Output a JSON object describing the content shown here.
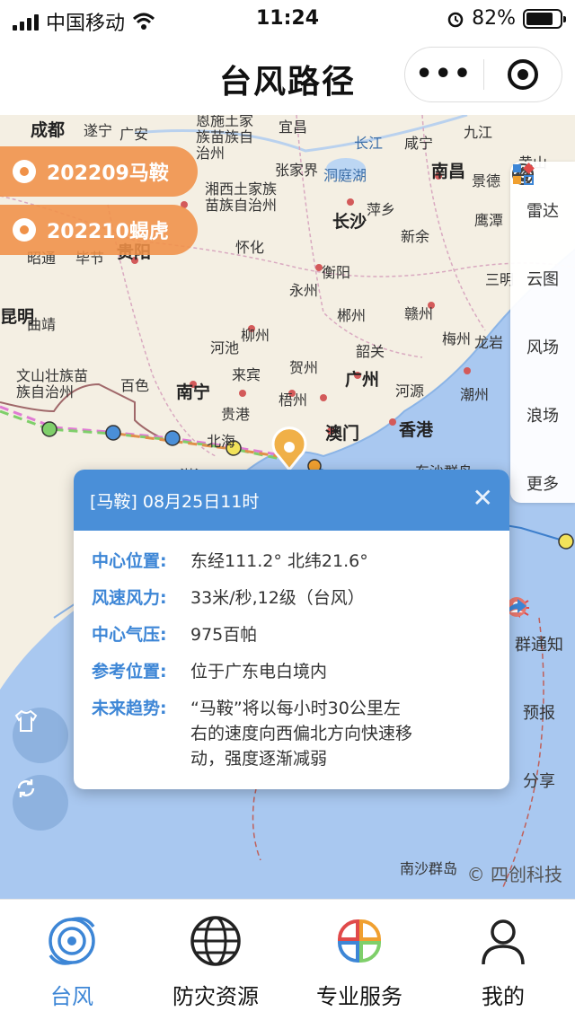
{
  "status_bar": {
    "carrier": "中国移动",
    "time": "11:24",
    "battery": "82%"
  },
  "header": {
    "title": "台风路径",
    "more_label": "•••"
  },
  "typhoons": [
    {
      "label": "202209马鞍"
    },
    {
      "label": "202210蝎虎"
    }
  ],
  "map_labels": {
    "chengdu": "成都",
    "suining": "遂宁",
    "guangan": "广安",
    "yichang": "宜昌",
    "jiujiang": "九江",
    "huangshan": "黄山",
    "enshi": "恩施土家族苗族自治州",
    "changjiang": "长江",
    "xianning": "咸宁",
    "zhangjiajie": "张家界",
    "dongtinghu": "洞庭湖",
    "nanchang": "南昌",
    "jingdezhen": "景德",
    "xiangxi": "湘西土家族苗族自治州",
    "pingxiang": "萍乡",
    "yingtan": "鹰潭",
    "changsha": "长沙",
    "xinyu": "新余",
    "zhaotong": "昭通",
    "bijie": "毕节",
    "guiyang": "贵阳",
    "huaihua": "怀化",
    "hengyang": "衡阳",
    "sanming": "三明",
    "yongzhou": "永州",
    "chenzhou": "郴州",
    "ganzhou": "赣州",
    "kunming": "昆明",
    "qujing": "曲靖",
    "liuzhou": "柳州",
    "hechi": "河池",
    "shaoguan": "韶关",
    "meizhou": "梅州",
    "longyan": "龙岩",
    "wenshan": "文山壮族苗族自治州",
    "baise": "百色",
    "laibin": "来宾",
    "hezhou": "贺州",
    "guangzhou": "广州",
    "heyuan": "河源",
    "chaozhou": "潮州",
    "nanning": "南宁",
    "guigang": "贵港",
    "wuzhou": "梧州",
    "macau": "澳门",
    "hongkong": "香港",
    "beihai": "北海",
    "zhanjiang": "湛江",
    "dongsha": "东沙群岛",
    "nansha": "南沙群岛"
  },
  "side_buttons": [
    {
      "label": "雷达",
      "icon": "radar-icon"
    },
    {
      "label": "云图",
      "icon": "satellite-icon"
    },
    {
      "label": "风场",
      "icon": "wind-icon"
    },
    {
      "label": "浪场",
      "icon": "wave-icon"
    },
    {
      "label": "更多",
      "icon": "grid-icon"
    }
  ],
  "side_buttons2": [
    {
      "label": "群通知",
      "icon": "megaphone-icon"
    },
    {
      "label": "预报",
      "icon": "forecast-pin-icon"
    },
    {
      "label": "分享",
      "icon": "share-icon"
    }
  ],
  "copyright": "© 四创科技",
  "popup": {
    "title": "[马鞍] 08月25日11时",
    "rows": [
      {
        "label": "中心位置:",
        "value": "东经111.2°   北纬21.6°"
      },
      {
        "label": "风速风力:",
        "value": "33米/秒,12级（台风）"
      },
      {
        "label": "中心气压:",
        "value": "975百帕"
      },
      {
        "label": "参考位置:",
        "value": "位于广东电白境内"
      },
      {
        "label": "未来趋势:",
        "value": "“马鞍”将以每小时30公里左右的速度向西偏北方向快速移动，强度逐渐减弱"
      }
    ]
  },
  "tabs": [
    {
      "label": "台风",
      "icon": "typhoon-icon",
      "active": true
    },
    {
      "label": "防灾资源",
      "icon": "globe-icon"
    },
    {
      "label": "专业服务",
      "icon": "petals-icon"
    },
    {
      "label": "我的",
      "icon": "user-icon"
    }
  ],
  "colors": {
    "accent": "#3d86d6",
    "typhoon_button": "#f09148",
    "popup_header": "#4a8fd8"
  }
}
